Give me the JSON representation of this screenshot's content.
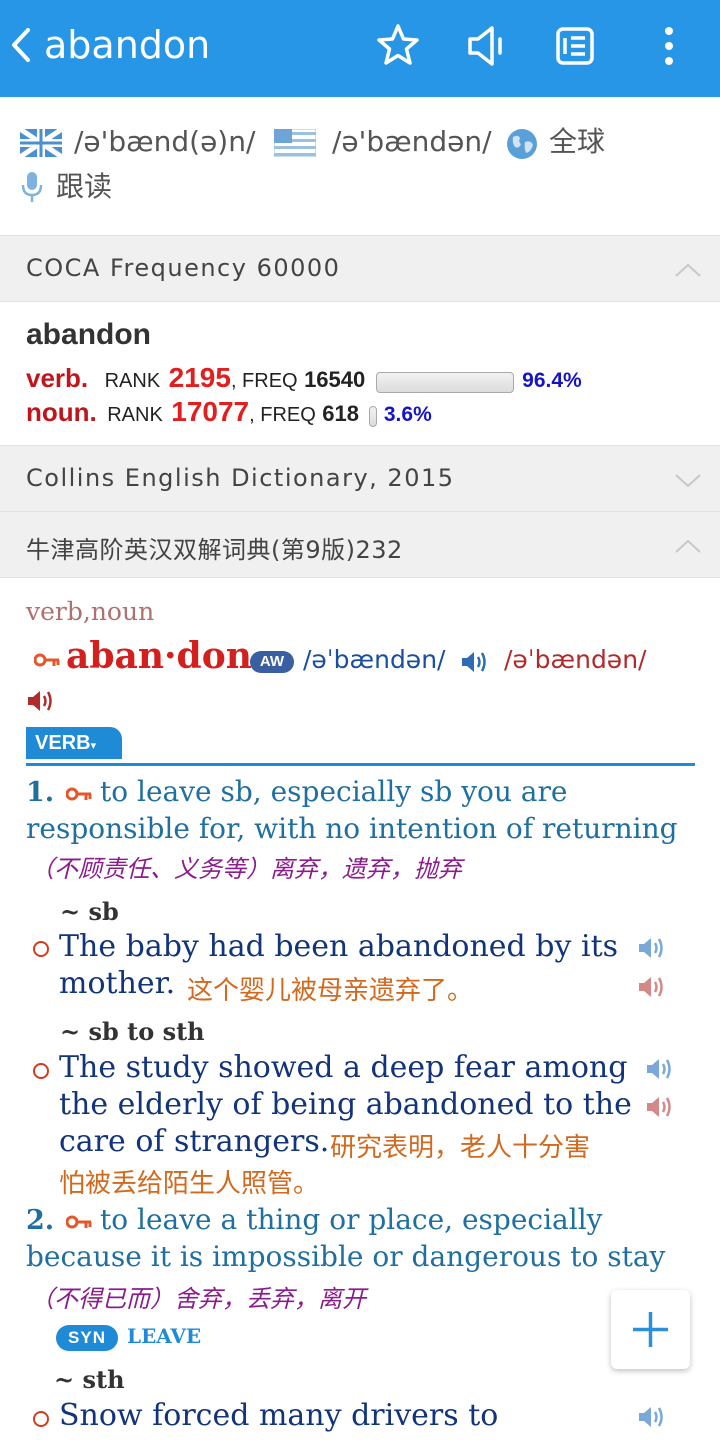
{
  "header": {
    "title": "abandon",
    "icons": [
      "back-chevron-icon",
      "star-icon",
      "speaker-icon",
      "list-icon",
      "more-vertical-icon"
    ]
  },
  "pronunciation": {
    "uk": "/ə'bænd(ə)n/",
    "us": "/ə'bændən/",
    "global_label": "全球",
    "follow_label": "跟读"
  },
  "coca": {
    "header": "COCA Frequency 60000",
    "word": "abandon",
    "rows": [
      {
        "pos": "verb.",
        "rank_label": "RANK",
        "rank": "2195",
        "freq_label": ", FREQ",
        "freq": "16540",
        "percent": "96.4%",
        "fraction": 0.964
      },
      {
        "pos": "noun.",
        "rank_label": "RANK",
        "rank": "17077",
        "freq_label": ", FREQ",
        "freq": "618",
        "percent": "3.6%",
        "fraction": 0.036
      }
    ]
  },
  "collins": {
    "header": "Collins English Dictionary, 2015"
  },
  "oxford": {
    "header": "牛津高阶英汉双解词典(第9版)232",
    "pos_line": "verb,noun",
    "headword": "aban·don",
    "aw_badge": "AW",
    "phon_uk": "/əˈbændən/",
    "phon_us": "/əˈbændən/",
    "verb_tab": "VERB",
    "senses": [
      {
        "num": "1.",
        "def_line1": "to leave sb, especially sb you are",
        "def_line2": "responsible for, with no intention of returning",
        "cn": "（不顾责任、义务等）离弃，遗弃，抛弃",
        "examples": [
          {
            "pattern": "~ sb",
            "en_line1": "The baby had been abandoned by its",
            "en_line2": "mother.",
            "cn": "这个婴儿被母亲遗弃了。"
          },
          {
            "pattern": "~ sb to sth",
            "en_line1": "The study showed a deep fear among",
            "en_line2": "the elderly of being abandoned to the",
            "en_line3": "care of strangers.",
            "cn_line1": "研究表明，老人十分害",
            "cn_line2": "怕被丢给陌生人照管。"
          }
        ]
      },
      {
        "num": "2.",
        "def_line1": "to leave a thing or place, especially",
        "def_line2": "because it is impossible or dangerous to stay",
        "cn": "（不得已而）舍弃，丢弃，离开",
        "syn_badge": "SYN",
        "syn_word": "LEAVE",
        "examples": [
          {
            "pattern": "~ sth",
            "en_line1": "Snow forced many drivers to"
          }
        ]
      }
    ]
  },
  "fab": {
    "icon": "plus-icon"
  },
  "colors": {
    "header_bar": "#2796e6",
    "pos_red": "#c0151b",
    "rank_red": "#e02020",
    "percent_blue": "#1515c8",
    "teal": "#1f6fa0",
    "navy": "#12347a",
    "cn_purple": "#8a1c8c",
    "cn_orange": "#d2691e"
  }
}
